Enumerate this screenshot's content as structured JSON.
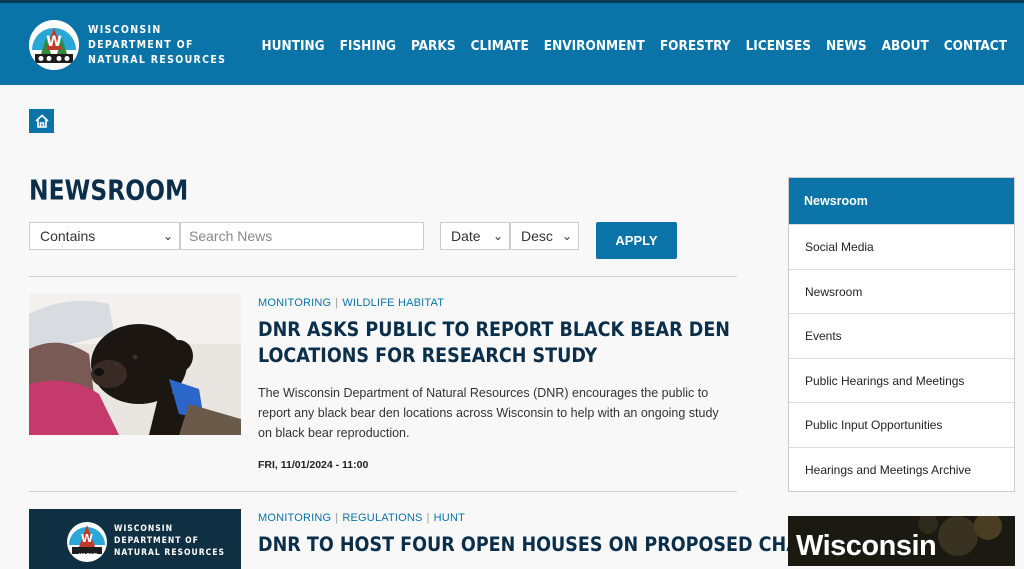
{
  "header": {
    "logo_lines": [
      "WISCONSIN",
      "DEPARTMENT OF",
      "NATURAL RESOURCES"
    ],
    "nav": [
      "HUNTING",
      "FISHING",
      "PARKS",
      "CLIMATE",
      "ENVIRONMENT",
      "FORESTRY",
      "LICENSES",
      "NEWS",
      "ABOUT",
      "CONTACT"
    ]
  },
  "page": {
    "title": "NEWSROOM"
  },
  "filters": {
    "match": "Contains",
    "search_placeholder": "Search News",
    "sort_field": "Date",
    "sort_order": "Desc",
    "apply_label": "APPLY"
  },
  "articles": [
    {
      "tags": [
        "MONITORING",
        "WILDLIFE HABITAT"
      ],
      "title": "DNR ASKS PUBLIC TO REPORT BLACK BEAR DEN LOCATIONS FOR RESEARCH STUDY",
      "description": "The Wisconsin Department of Natural Resources (DNR) encourages the public to report any black bear den locations across Wisconsin to help with an ongoing study on black bear reproduction.",
      "date": "FRI, 11/01/2024 - 11:00"
    },
    {
      "tags": [
        "MONITORING",
        "REGULATIONS",
        "HUNT"
      ],
      "title": "DNR TO HOST FOUR OPEN HOUSES ON PROPOSED CHANGES TO",
      "thumb_lines": [
        "WISCONSIN",
        "DEPARTMENT OF",
        "NATURAL RESOURCES"
      ],
      "thumb_badge": "WI DNR"
    }
  ],
  "sidebar": {
    "active": "Newsroom",
    "items": [
      "Social Media",
      "Newsroom",
      "Events",
      "Public Hearings and Meetings",
      "Public Input Opportunities",
      "Hearings and Meetings Archive"
    ],
    "promo_text": "Wisconsin"
  },
  "colors": {
    "brand": "#0a74a8",
    "navy": "#0b2f4a"
  }
}
